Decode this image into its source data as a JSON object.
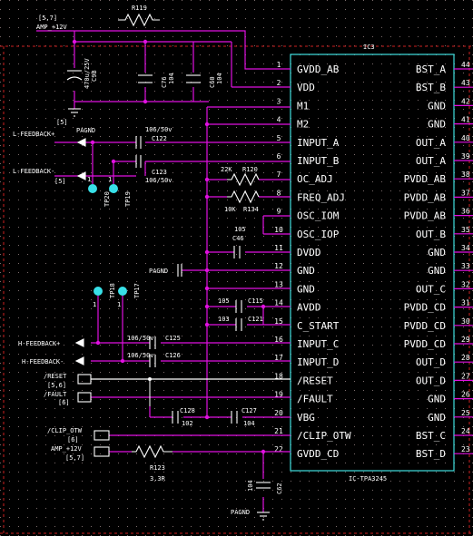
{
  "ic": {
    "ref": "IC3",
    "part": "IC-TPA3245",
    "left_pins": [
      {
        "num": "1",
        "name": "GVDD_AB"
      },
      {
        "num": "2",
        "name": "VDD"
      },
      {
        "num": "3",
        "name": "M1"
      },
      {
        "num": "4",
        "name": "M2"
      },
      {
        "num": "5",
        "name": "INPUT_A"
      },
      {
        "num": "6",
        "name": "INPUT_B"
      },
      {
        "num": "7",
        "name": "OC_ADJ"
      },
      {
        "num": "8",
        "name": "FREQ_ADJ"
      },
      {
        "num": "9",
        "name": "OSC_IOM"
      },
      {
        "num": "10",
        "name": "OSC_IOP"
      },
      {
        "num": "11",
        "name": "DVDD"
      },
      {
        "num": "12",
        "name": "GND"
      },
      {
        "num": "13",
        "name": "GND"
      },
      {
        "num": "14",
        "name": "AVDD"
      },
      {
        "num": "15",
        "name": "C_START"
      },
      {
        "num": "16",
        "name": "INPUT_C"
      },
      {
        "num": "17",
        "name": "INPUT_D"
      },
      {
        "num": "18",
        "name": "/RESET"
      },
      {
        "num": "19",
        "name": "/FAULT"
      },
      {
        "num": "20",
        "name": "VBG"
      },
      {
        "num": "21",
        "name": "/CLIP_OTW"
      },
      {
        "num": "22",
        "name": "GVDD_CD"
      }
    ],
    "right_pins": [
      {
        "num": "44",
        "name": "BST_A"
      },
      {
        "num": "43",
        "name": "BST_B"
      },
      {
        "num": "42",
        "name": "GND"
      },
      {
        "num": "41",
        "name": "GND"
      },
      {
        "num": "40",
        "name": "OUT_A"
      },
      {
        "num": "39",
        "name": "OUT_A"
      },
      {
        "num": "38",
        "name": "PVDD_AB"
      },
      {
        "num": "37",
        "name": "PVDD_AB"
      },
      {
        "num": "36",
        "name": "PVDD_AB"
      },
      {
        "num": "35",
        "name": "OUT_B"
      },
      {
        "num": "34",
        "name": "GND"
      },
      {
        "num": "33",
        "name": "GND"
      },
      {
        "num": "32",
        "name": "OUT_C"
      },
      {
        "num": "31",
        "name": "PVDD_CD"
      },
      {
        "num": "30",
        "name": "PVDD_CD"
      },
      {
        "num": "29",
        "name": "PVDD_CD"
      },
      {
        "num": "28",
        "name": "OUT_D"
      },
      {
        "num": "27",
        "name": "OUT_D"
      },
      {
        "num": "26",
        "name": "GND"
      },
      {
        "num": "25",
        "name": "GND"
      },
      {
        "num": "24",
        "name": "BST_C"
      },
      {
        "num": "23",
        "name": "BST_D"
      }
    ]
  },
  "nets": {
    "amp12_top": "AMP_+12V",
    "amp12_top_ref": "[5,7]",
    "amp12_bot": "AMP_+12V",
    "amp12_bot_ref": "[5,7]",
    "l_fb_plus": "L-FEEDBACK+",
    "l_fb_minus": "L-FEEDBACK-",
    "l_fb_ref_a": "[5]",
    "l_fb_ref_b": "[5]",
    "h_fb_plus": "H-FEEDBACK+",
    "h_fb_minus": "H-FEEDBACK-",
    "reset": "/RESET",
    "reset_ref": "[5,6]",
    "fault": "/FAULT",
    "fault_ref": "[6]",
    "clip": "/CLIP_OTW",
    "clip_ref": "[6]",
    "pagnd_1": "PAGND",
    "pagnd_2": "PAGND",
    "pagnd_3": "PAGND"
  },
  "components": {
    "r119": "R119",
    "c_bulk_val": "470u/25V",
    "c_bulk_ref": "C9B",
    "c76": "C76",
    "c76_val": "104",
    "c60": "C60",
    "c60_val": "104",
    "c122_val": "106/50v",
    "c122": "C122",
    "c123": "C123",
    "c123_val": "106/50v",
    "r120": "R120",
    "r120_val": "22K",
    "r134": "R134",
    "r134_val": "10K",
    "c46": "C46",
    "c46_val": "105",
    "c115": "C115",
    "c115_val": "105",
    "c121": "C121",
    "c121_val": "103",
    "c125": "C125",
    "c125_val": "106/50v",
    "c126": "C126",
    "c126_val": "106/50v",
    "c128": "C128",
    "c128_val": "102",
    "c127": "C127",
    "c127_val": "104",
    "r123": "R123",
    "r123_val": "3.3R",
    "c62": "C62",
    "c62_val": "104",
    "tp20": "TP20",
    "tp19": "TP19",
    "tp18": "TP18",
    "tp17": "TP17",
    "tp_pin": "1"
  },
  "colors": {
    "wire": "#e010e0",
    "component": "#ffffff",
    "ic_box": "#40e0e0",
    "testpoint": "#38e0e8",
    "border": "#cc2020",
    "background": "#000000"
  }
}
